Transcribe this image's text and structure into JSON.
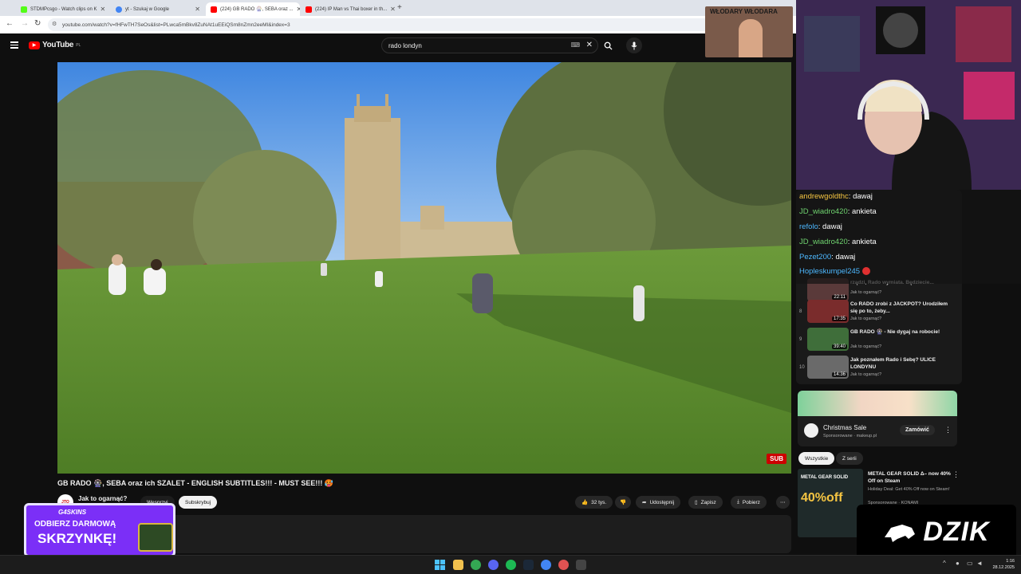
{
  "browser": {
    "tabs": [
      {
        "title": "STDMPcsgo - Watch clips on K",
        "color": "#53fc18",
        "active": false
      },
      {
        "title": "yt - Szukaj w Google",
        "color": "#4285f4",
        "active": false
      },
      {
        "title": "(224) GB RADO 🎡, SEBA oraz ...",
        "color": "#ff0000",
        "active": true
      },
      {
        "title": "(224) IP Man vs Thai boxer in th...",
        "color": "#ff0000",
        "active": false
      }
    ],
    "url": "youtube.com/watch?v=fHFwTH7SeOs&list=PLwca5mBkv8ZuNAt1uEEiQSm8nZmn2eeMI&index=3"
  },
  "youtube": {
    "logo_text": "YouTube",
    "logo_region": "PL",
    "search_value": "rado londyn",
    "video_title": "GB RADO 🎡, SEBA oraz ich SZALET - ENGLISH SUBTITLES!!! - MUST SEE!!! 🥵",
    "channel_name": "Jak to ogarnąć?",
    "channel_avatar_text": "JTO",
    "support_label": "Wesprzyj",
    "subscribe_label": "Subskrybuj",
    "likes": "32 tys.",
    "share_label": "Udostępnij",
    "save_label": "Zapisz",
    "download_label": "Pobierz",
    "sub_badge": "SUB"
  },
  "playlist": [
    {
      "index": "",
      "title": "rządzi, Rado wymiata. Będziecie...",
      "duration": "22:11",
      "channel": "Jak to ogarnąć?",
      "color": "#5a3a3a"
    },
    {
      "index": "8",
      "title": "Co RADO zrobi z JACKPOT? Urodziłem się po to, żeby...",
      "duration": "17:35",
      "channel": "Jak to ogarnąć?",
      "color": "#7a2c2c"
    },
    {
      "index": "9",
      "title": "GB RADO 🎡 - Nie dygaj na robocie!",
      "duration": "39:40",
      "channel": "Jak to ogarnąć?",
      "color": "#3f6e3a"
    },
    {
      "index": "10",
      "title": "Jak poznałem Rado i Sebę? ULICE LONDYNU",
      "duration": "14:36",
      "channel": "Jak to ogarnąć?",
      "color": "#6a6a6a"
    }
  ],
  "ad": {
    "title": "Christmas Sale",
    "sponsor": "Sponsorowane · makeup.pl",
    "cta": "Zamówić"
  },
  "filters": [
    "Wszystkie",
    "Z serii"
  ],
  "rec": {
    "title": "METAL GEAR SOLID Δ– now 40% Off on Steam",
    "desc": "Holiday Deal: Get 40% Off now on Steam!",
    "sponsor": "Sponsorowane · KONAMI",
    "thumb_text": "METAL GEAR SOLID",
    "thumb_sale": "40%off"
  },
  "stream_overlay": {
    "sponsor_brand": "G4SKINS",
    "promo_line1": "ODBIERZ DARMOWĄ",
    "promo_line2": "SKRZYNKĘ!",
    "brand_logo": "DZIK",
    "banner_top": "WŁODARY WŁODARA"
  },
  "chat": [
    {
      "user": "andrewgoldthc",
      "text": "dawaj",
      "color": "#f5c542"
    },
    {
      "user": "JD_wiadro420",
      "text": "ankieta",
      "color": "#6fd36f"
    },
    {
      "user": "refolo",
      "text": "dawaj",
      "color": "#4db8ff"
    },
    {
      "user": "JD_wiadro420",
      "text": "ankieta",
      "color": "#6fd36f"
    },
    {
      "user": "Pezet200",
      "text": "dawaj",
      "color": "#4db8ff"
    },
    {
      "user": "Hopleskumpel245",
      "text": "",
      "color": "#4db8ff"
    }
  ],
  "taskbar": {
    "clock_time": "1:16",
    "clock_date": "28.12.2025"
  },
  "colors": {
    "youtube_red": "#ff0000",
    "dark_bg": "#0f0f0f",
    "promo_purple": "#7b2ff7"
  }
}
